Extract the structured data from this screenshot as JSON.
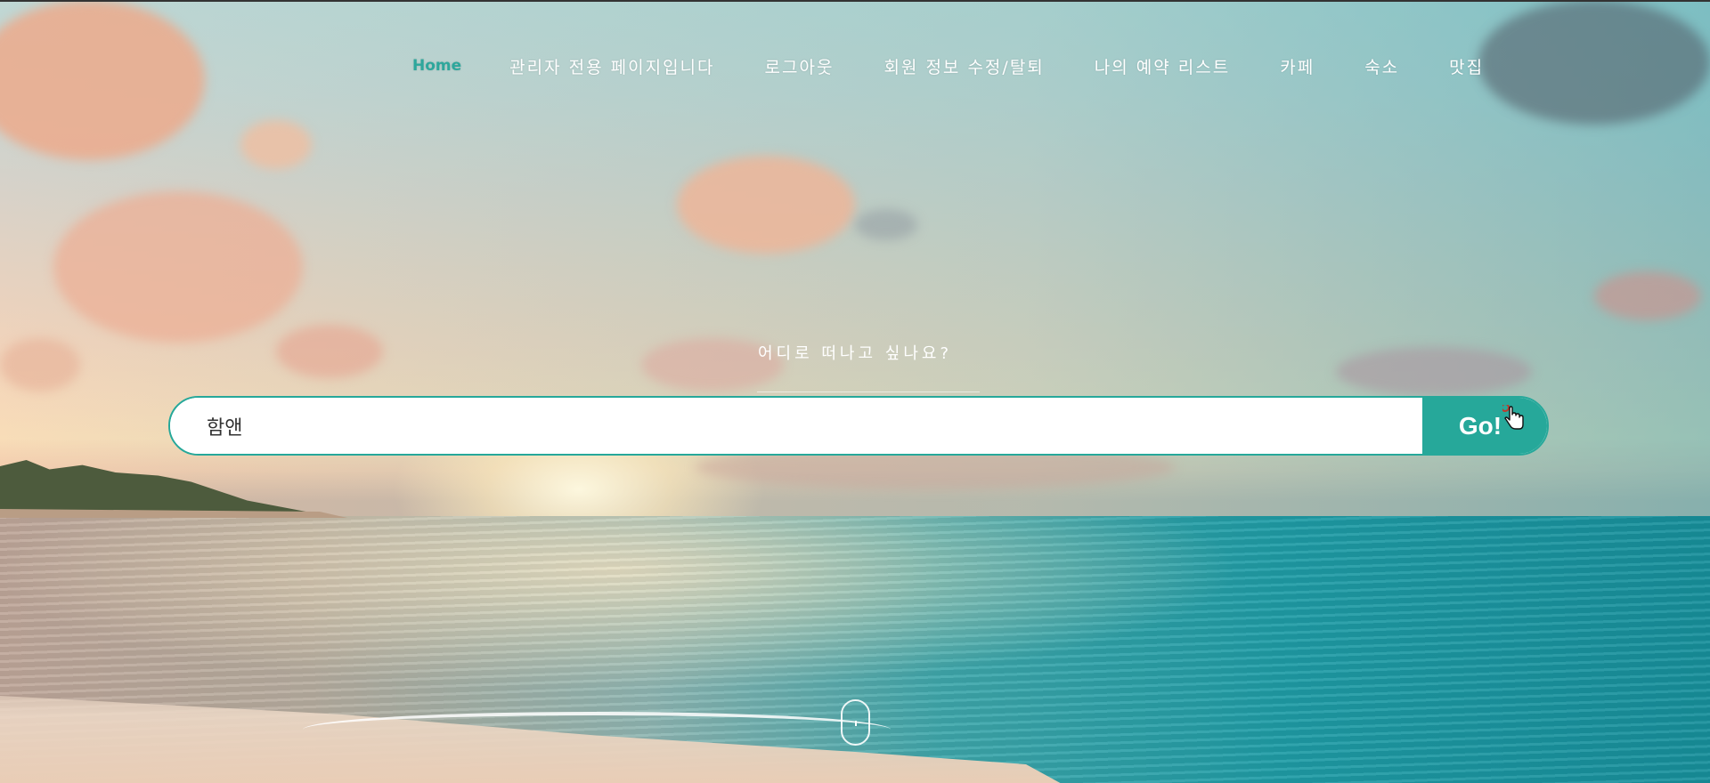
{
  "nav": {
    "items": [
      {
        "label": "Home",
        "active": true
      },
      {
        "label": "관리자 전용 페이지입니다"
      },
      {
        "label": "로그아웃"
      },
      {
        "label": "회원 정보 수정/탈퇴"
      },
      {
        "label": "나의 예약 리스트"
      },
      {
        "label": "카페"
      },
      {
        "label": "숙소"
      },
      {
        "label": "맛집"
      }
    ]
  },
  "hero": {
    "tagline": "어디로 떠나고 싶나요?"
  },
  "search": {
    "value": "함앤",
    "button_label": "Go!"
  },
  "colors": {
    "accent": "#26a89a",
    "nav_active": "#2ea79c",
    "text_light": "#ffffff"
  },
  "icons": {
    "cursor": "hand-pointer-icon",
    "scroll": "mouse-scroll-icon"
  }
}
